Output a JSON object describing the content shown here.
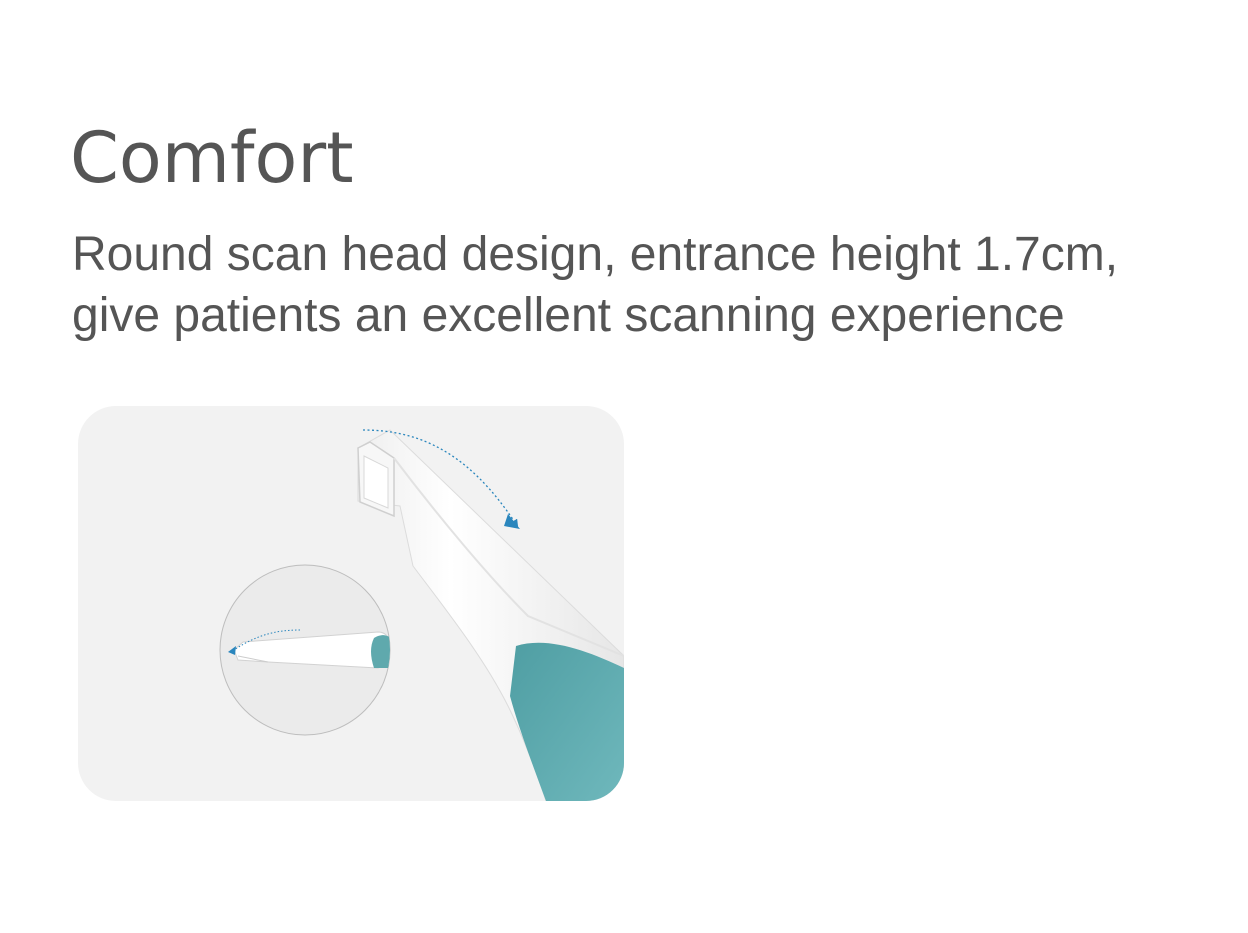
{
  "heading": {
    "title": "Comfort",
    "description_line1": "Round scan head design, entrance height 1.7cm,",
    "description_line2": "give patients an excellent scanning experience"
  },
  "illustration": {
    "subject": "intraoral-scanner-head",
    "colors": {
      "background": "#f2f2f2",
      "scanner_body": "#ffffff",
      "scanner_grip": "#5fa9ad",
      "arrow": "#2a86bd",
      "inset_circle": "#ebebeb"
    }
  }
}
